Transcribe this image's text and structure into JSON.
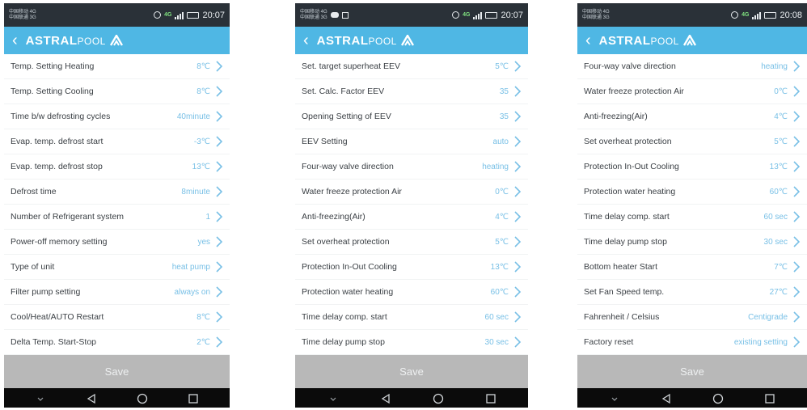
{
  "accent": "#4fb7e4",
  "value_color": "#79c0e6",
  "screens": [
    {
      "carrier": [
        "中国移动 4G",
        "中国联通 3G"
      ],
      "time": "20:07",
      "network": "4G",
      "brand_bold": "ASTRAL",
      "brand_light": "POOL",
      "save_label": "Save",
      "rows": [
        {
          "label": "Temp. Setting Heating",
          "value": "8℃"
        },
        {
          "label": "Temp. Setting Cooling",
          "value": "8℃"
        },
        {
          "label": "Time b/w defrosting cycles",
          "value": "40minute"
        },
        {
          "label": "Evap. temp. defrost start",
          "value": "-3℃"
        },
        {
          "label": "Evap. temp. defrost stop",
          "value": "13℃"
        },
        {
          "label": "Defrost time",
          "value": "8minute"
        },
        {
          "label": "Number of Refrigerant system",
          "value": "1"
        },
        {
          "label": "Power-off memory setting",
          "value": "yes"
        },
        {
          "label": "Type of unit",
          "value": "heat pump"
        },
        {
          "label": "Filter pump setting",
          "value": "always on"
        },
        {
          "label": "Cool/Heat/AUTO Restart",
          "value": "8℃"
        },
        {
          "label": "Delta Temp. Start-Stop",
          "value": "2℃"
        }
      ]
    },
    {
      "carrier": [
        "中国移动 4G",
        "中国联通 3G"
      ],
      "time": "20:07",
      "network": "4G",
      "brand_bold": "ASTRAL",
      "brand_light": "POOL",
      "save_label": "Save",
      "rows": [
        {
          "label": "Set. target superheat EEV",
          "value": "5℃"
        },
        {
          "label": "Set. Calc. Factor EEV",
          "value": "35"
        },
        {
          "label": "Opening Setting of EEV",
          "value": "35"
        },
        {
          "label": "EEV Setting",
          "value": "auto"
        },
        {
          "label": "Four-way valve direction",
          "value": "heating"
        },
        {
          "label": "Water freeze protection Air",
          "value": "0℃"
        },
        {
          "label": "Anti-freezing(Air)",
          "value": "4℃"
        },
        {
          "label": "Set overheat protection",
          "value": "5℃"
        },
        {
          "label": "Protection In-Out Cooling",
          "value": "13℃"
        },
        {
          "label": "Protection water heating",
          "value": "60℃"
        },
        {
          "label": "Time delay comp. start",
          "value": "60 sec"
        },
        {
          "label": "Time delay pump stop",
          "value": "30 sec"
        }
      ]
    },
    {
      "carrier": [
        "中国移动 4G",
        "中国联通 3G"
      ],
      "time": "20:08",
      "network": "4G",
      "brand_bold": "ASTRAL",
      "brand_light": "POOL",
      "save_label": "Save",
      "rows": [
        {
          "label": "Four-way valve direction",
          "value": "heating"
        },
        {
          "label": "Water freeze protection Air",
          "value": "0℃"
        },
        {
          "label": "Anti-freezing(Air)",
          "value": "4℃"
        },
        {
          "label": "Set overheat protection",
          "value": "5℃"
        },
        {
          "label": "Protection In-Out Cooling",
          "value": "13℃"
        },
        {
          "label": "Protection water heating",
          "value": "60℃"
        },
        {
          "label": "Time delay comp. start",
          "value": "60 sec"
        },
        {
          "label": "Time delay pump stop",
          "value": "30 sec"
        },
        {
          "label": "Bottom heater Start",
          "value": "7℃"
        },
        {
          "label": "Set Fan Speed temp.",
          "value": "27℃"
        },
        {
          "label": "Fahrenheit / Celsius",
          "value": "Centigrade"
        },
        {
          "label": "Factory reset",
          "value": "existing setting"
        }
      ]
    }
  ]
}
